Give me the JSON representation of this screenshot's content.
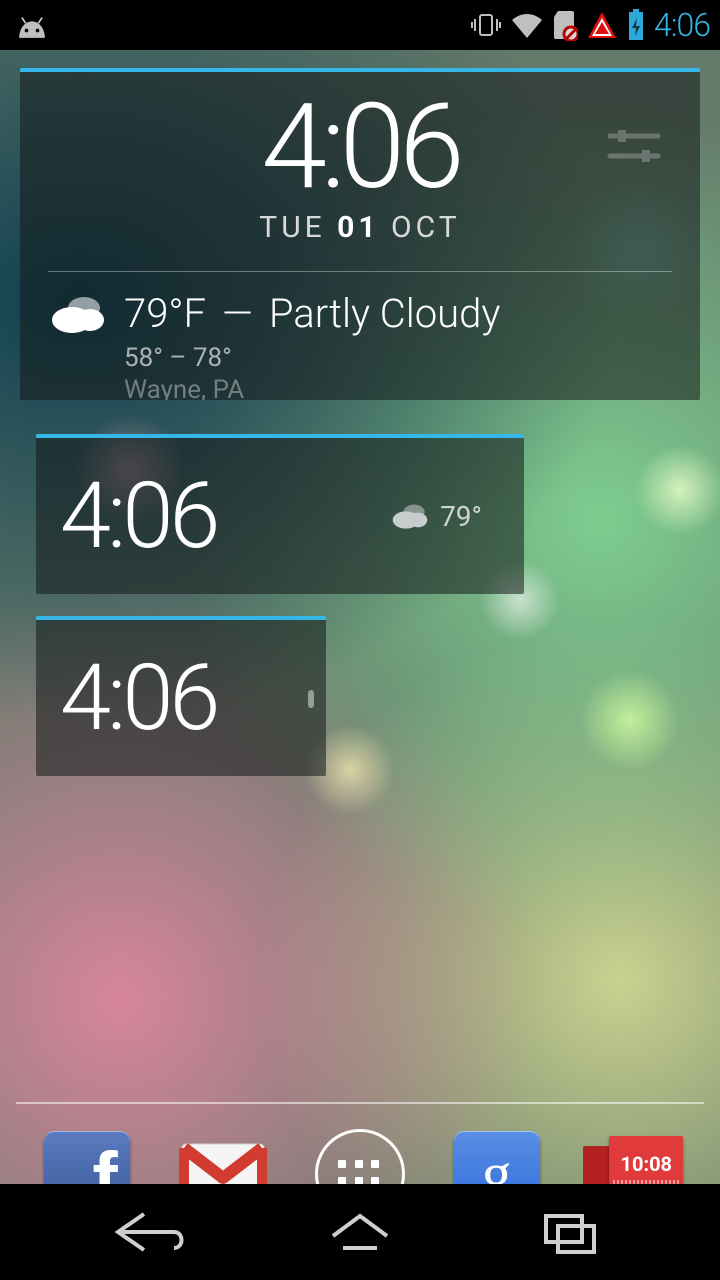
{
  "status": {
    "time": "4:06",
    "icons": [
      "vibrate-icon",
      "wifi-icon",
      "sd-blocked-icon",
      "warning-icon",
      "battery-charging-icon"
    ]
  },
  "widgets": {
    "large": {
      "time": "4:06",
      "date_day": "TUE",
      "date_num": "01",
      "date_month": "OCT",
      "weather_temp": "79°F",
      "weather_sep": "—",
      "weather_desc": "Partly Cloudy",
      "range": "58° – 78°",
      "location": "Wayne, PA"
    },
    "medium": {
      "time": "4:06",
      "temp": "79°"
    },
    "small": {
      "time": "4:06"
    }
  },
  "dock": {
    "apps": [
      "Facebook",
      "Gmail",
      "Apps",
      "Google",
      "Clock"
    ],
    "clock_app_time": "10:08"
  },
  "colors": {
    "accent": "#35b7e8",
    "status_time": "#33b5e5"
  }
}
